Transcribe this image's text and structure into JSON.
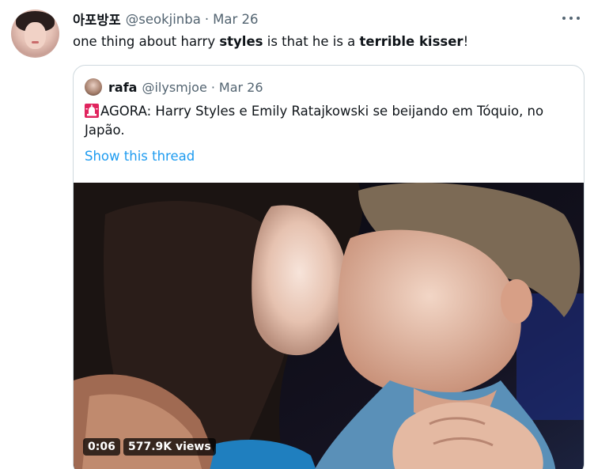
{
  "tweet": {
    "display_name": "아포방포",
    "handle": "@seokjinba",
    "separator": "·",
    "date": "Mar 26",
    "text_parts": [
      "one thing about harry ",
      "styles",
      " is that he is a ",
      "terrible kisser",
      "!"
    ]
  },
  "quote": {
    "display_name": "rafa",
    "handle": "@ilysmjoe",
    "separator": "·",
    "date": "Mar 26",
    "text": "AGORA: Harry Styles e Emily Ratajkowski se beijando em Tóquio, no Japão.",
    "icon": "siren-icon",
    "show_thread": "Show this thread",
    "video": {
      "duration": "0:06",
      "views": "577.9K views"
    }
  },
  "colors": {
    "link": "#1d9bf0",
    "secondary_text": "#536471",
    "border": "#cfd9de"
  }
}
